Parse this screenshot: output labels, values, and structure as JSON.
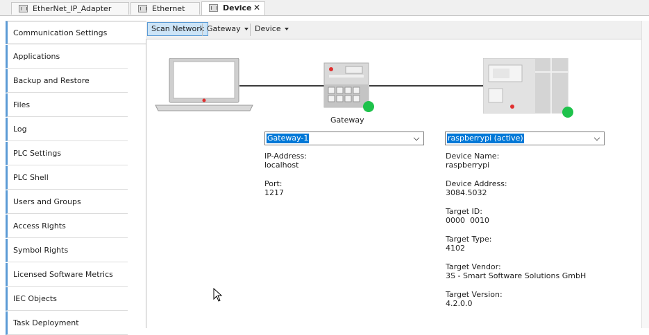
{
  "tabs": [
    {
      "label": "EtherNet_IP_Adapter",
      "active": false
    },
    {
      "label": "Ethernet",
      "active": false
    },
    {
      "label": "Device",
      "active": true
    }
  ],
  "sidebar": {
    "items": [
      {
        "label": "Communication Settings"
      },
      {
        "label": "Applications"
      },
      {
        "label": "Backup and Restore"
      },
      {
        "label": "Files"
      },
      {
        "label": "Log"
      },
      {
        "label": "PLC Settings"
      },
      {
        "label": "PLC Shell"
      },
      {
        "label": "Users and Groups"
      },
      {
        "label": "Access Rights"
      },
      {
        "label": "Symbol Rights"
      },
      {
        "label": "Licensed Software Metrics"
      },
      {
        "label": "IEC Objects"
      },
      {
        "label": "Task Deployment"
      }
    ]
  },
  "toolbar": {
    "scan_network": "Scan Network",
    "gateway": "Gateway",
    "device": "Device"
  },
  "gateway": {
    "caption": "Gateway",
    "selected": "Gateway-1",
    "fields": [
      {
        "label": "IP-Address:",
        "value": "localhost"
      },
      {
        "label": "Port:",
        "value": "1217"
      }
    ]
  },
  "device": {
    "selected": "raspberrypi (active)",
    "fields": [
      {
        "label": "Device Name:",
        "value": "raspberrypi"
      },
      {
        "label": "Device Address:",
        "value": "3084.5032"
      },
      {
        "label": "Target ID:",
        "value": "0000  0010"
      },
      {
        "label": "Target Type:",
        "value": "4102"
      },
      {
        "label": "Target Vendor:",
        "value": "3S - Smart Software Solutions GmbH"
      },
      {
        "label": "Target Version:",
        "value": "4.2.0.0"
      }
    ]
  },
  "colors": {
    "accent": "#5b9bd5",
    "selection": "#0078d7",
    "status_ok": "#1ec24b"
  }
}
